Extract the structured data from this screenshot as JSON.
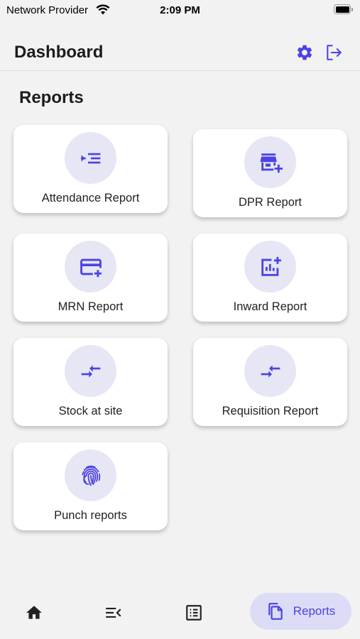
{
  "status_bar": {
    "carrier": "Network Provider",
    "time": "2:09 PM"
  },
  "header": {
    "title": "Dashboard",
    "settings_icon": "gear-icon",
    "logout_icon": "logout-icon"
  },
  "section": {
    "title": "Reports"
  },
  "reports": [
    {
      "label": "Attendance Report",
      "icon": "indent-list-icon"
    },
    {
      "label": "DPR Report",
      "icon": "store-add-icon"
    },
    {
      "label": "MRN Report",
      "icon": "card-add-icon"
    },
    {
      "label": "Inward Report",
      "icon": "chart-add-icon"
    },
    {
      "label": "Stock at site",
      "icon": "swap-arrows-icon"
    },
    {
      "label": "Requisition Report",
      "icon": "swap-arrows-icon"
    },
    {
      "label": "Punch reports",
      "icon": "fingerprint-icon"
    }
  ],
  "bottom_nav": {
    "home_icon": "home-icon",
    "menu_icon": "menu-collapse-icon",
    "list_icon": "list-icon",
    "reports_label": "Reports",
    "reports_icon": "copy-documents-icon"
  },
  "colors": {
    "accent": "#4c43e0",
    "icon_bg": "#e6e6f5",
    "nav_active_bg": "#dcdcf6",
    "background": "#f2f2f2"
  }
}
